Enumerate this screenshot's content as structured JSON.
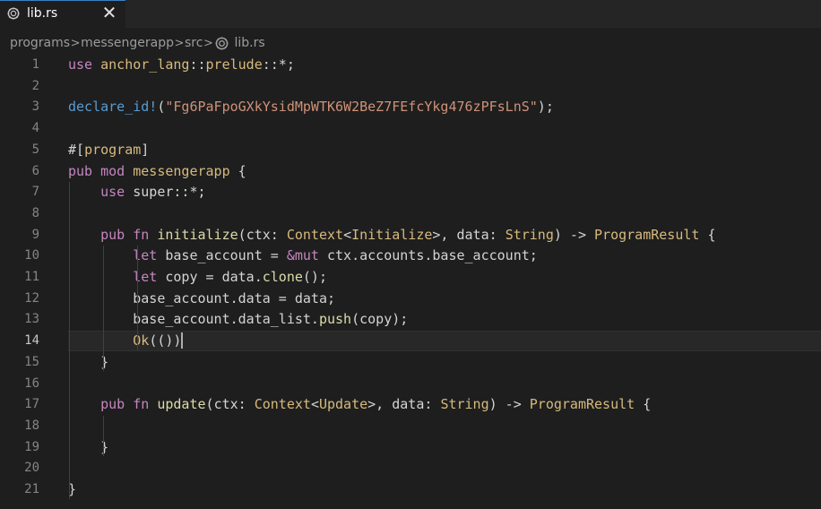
{
  "tab": {
    "label": "lib.rs",
    "close_glyph": "✕",
    "icon": "rust-gear-icon"
  },
  "breadcrumb": {
    "items": [
      "programs",
      "messengerapp",
      "src",
      "lib.rs"
    ],
    "separator": ">"
  },
  "editor": {
    "current_line": 14,
    "lines": [
      {
        "n": "1",
        "tokens": [
          [
            "kw",
            "use"
          ],
          [
            "id",
            " "
          ],
          [
            "ty",
            "anchor_lang"
          ],
          [
            "punc",
            "::"
          ],
          [
            "ty",
            "prelude"
          ],
          [
            "punc",
            "::*;"
          ]
        ]
      },
      {
        "n": "2",
        "tokens": []
      },
      {
        "n": "3",
        "tokens": [
          [
            "mac",
            "declare_id!"
          ],
          [
            "punc",
            "("
          ],
          [
            "str",
            "\"Fg6PaFpoGXkYsidMpWTK6W2BeZ7FEfcYkg476zPFsLnS\""
          ],
          [
            "punc",
            ");"
          ]
        ]
      },
      {
        "n": "4",
        "tokens": []
      },
      {
        "n": "5",
        "tokens": [
          [
            "punc",
            "#["
          ],
          [
            "ty",
            "program"
          ],
          [
            "punc",
            "]"
          ]
        ]
      },
      {
        "n": "6",
        "tokens": [
          [
            "kw",
            "pub"
          ],
          [
            "id",
            " "
          ],
          [
            "kw",
            "mod"
          ],
          [
            "id",
            " "
          ],
          [
            "ty",
            "messengerapp"
          ],
          [
            "id",
            " "
          ],
          [
            "punc",
            "{"
          ]
        ]
      },
      {
        "n": "7",
        "tokens": [
          [
            "id",
            "    "
          ],
          [
            "kw",
            "use"
          ],
          [
            "id",
            " super"
          ],
          [
            "punc",
            "::*;"
          ]
        ]
      },
      {
        "n": "8",
        "tokens": []
      },
      {
        "n": "9",
        "tokens": [
          [
            "id",
            "    "
          ],
          [
            "kw",
            "pub"
          ],
          [
            "id",
            " "
          ],
          [
            "kw",
            "fn"
          ],
          [
            "id",
            " "
          ],
          [
            "fn",
            "initialize"
          ],
          [
            "punc",
            "("
          ],
          [
            "id",
            "ctx"
          ],
          [
            "punc",
            ": "
          ],
          [
            "ty",
            "Context"
          ],
          [
            "punc",
            "<"
          ],
          [
            "ty",
            "Initialize"
          ],
          [
            "punc",
            ">, "
          ],
          [
            "id",
            "data"
          ],
          [
            "punc",
            ": "
          ],
          [
            "ty",
            "String"
          ],
          [
            "punc",
            ") -> "
          ],
          [
            "ty",
            "ProgramResult"
          ],
          [
            "punc",
            " {"
          ]
        ]
      },
      {
        "n": "10",
        "tokens": [
          [
            "id",
            "        "
          ],
          [
            "kw",
            "let"
          ],
          [
            "id",
            " base_account = "
          ],
          [
            "kw",
            "&mut"
          ],
          [
            "id",
            " ctx.accounts.base_account;"
          ]
        ]
      },
      {
        "n": "11",
        "tokens": [
          [
            "id",
            "        "
          ],
          [
            "kw",
            "let"
          ],
          [
            "id",
            " copy = data."
          ],
          [
            "fn",
            "clone"
          ],
          [
            "punc",
            "();"
          ]
        ]
      },
      {
        "n": "12",
        "tokens": [
          [
            "id",
            "        base_account.data = data;"
          ]
        ]
      },
      {
        "n": "13",
        "tokens": [
          [
            "id",
            "        base_account.data_list."
          ],
          [
            "fn",
            "push"
          ],
          [
            "punc",
            "(copy);"
          ]
        ]
      },
      {
        "n": "14",
        "tokens": [
          [
            "id",
            "        "
          ],
          [
            "ty",
            "Ok"
          ],
          [
            "punc",
            "(())"
          ]
        ]
      },
      {
        "n": "15",
        "tokens": [
          [
            "id",
            "    "
          ],
          [
            "punc",
            "}"
          ]
        ]
      },
      {
        "n": "16",
        "tokens": []
      },
      {
        "n": "17",
        "tokens": [
          [
            "id",
            "    "
          ],
          [
            "kw",
            "pub"
          ],
          [
            "id",
            " "
          ],
          [
            "kw",
            "fn"
          ],
          [
            "id",
            " "
          ],
          [
            "fn",
            "update"
          ],
          [
            "punc",
            "("
          ],
          [
            "id",
            "ctx"
          ],
          [
            "punc",
            ": "
          ],
          [
            "ty",
            "Context"
          ],
          [
            "punc",
            "<"
          ],
          [
            "ty",
            "Update"
          ],
          [
            "punc",
            ">, "
          ],
          [
            "id",
            "data"
          ],
          [
            "punc",
            ": "
          ],
          [
            "ty",
            "String"
          ],
          [
            "punc",
            ") -> "
          ],
          [
            "ty",
            "ProgramResult"
          ],
          [
            "punc",
            " {"
          ]
        ]
      },
      {
        "n": "18",
        "tokens": []
      },
      {
        "n": "19",
        "tokens": [
          [
            "id",
            "    "
          ],
          [
            "punc",
            "}"
          ]
        ]
      },
      {
        "n": "20",
        "tokens": []
      },
      {
        "n": "21",
        "tokens": [
          [
            "punc",
            "}"
          ]
        ]
      }
    ]
  },
  "colors": {
    "keyword": "#c586c0",
    "type": "#d7ba7d",
    "string": "#b5cea8",
    "macro": "#569cd6",
    "function": "#dcdcaa",
    "identifier": "#d4d4d4",
    "line_number": "#858585",
    "background": "#1e1e1e"
  }
}
